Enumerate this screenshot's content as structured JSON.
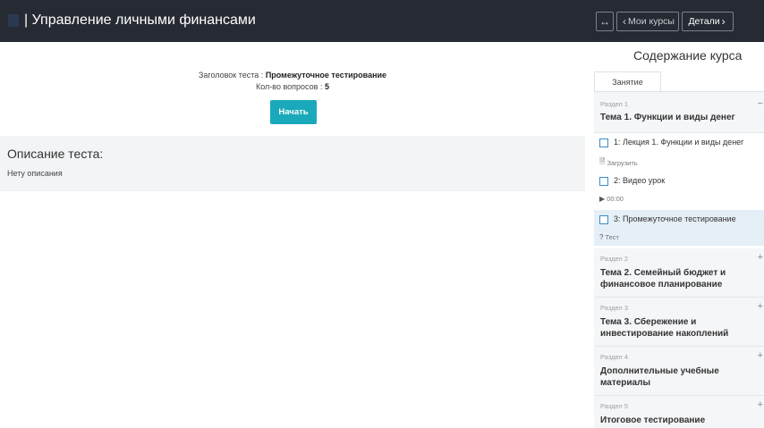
{
  "header": {
    "title": "| Управление личными финансами",
    "expand_icon": "arrows-horizontal-icon",
    "my_courses": "Мои курсы",
    "details": "Детали"
  },
  "test": {
    "title_label": "Заголовок теста :",
    "title_value": "Промежуточное тестирование",
    "count_label": "Кол-во вопросов :",
    "count_value": "5",
    "start_button": "Начать"
  },
  "description": {
    "heading": "Описание теста:",
    "text": "Нету описания"
  },
  "sidebar": {
    "title": "Содержание курса",
    "tab": "Занятие",
    "sections": [
      {
        "label": "Раздел 1",
        "name": "Тема 1. Функции и виды денег",
        "toggle": "−"
      },
      {
        "label": "Раздел 2",
        "name": "Тема 2. Семейный бюджет и финансовое планирование",
        "toggle": "+"
      },
      {
        "label": "Раздел 3",
        "name": "Тема 3. Сбережение и инвестирование накоплений",
        "toggle": "+"
      },
      {
        "label": "Раздел 4",
        "name": "Дополнительные учебные материалы",
        "toggle": "+"
      },
      {
        "label": "Раздел 5",
        "name": "Итоговое тестирование",
        "toggle": "+"
      }
    ],
    "lessons": [
      {
        "title": "1: Лекция 1. Функции и виды денег",
        "meta": "Загрузить",
        "icon": "document-icon"
      },
      {
        "title": "2: Видео урок",
        "meta": "00:00",
        "icon": "play-icon"
      },
      {
        "title": "3: Промежуточное тестирование",
        "meta": "Тест",
        "icon": "question-icon"
      }
    ]
  }
}
